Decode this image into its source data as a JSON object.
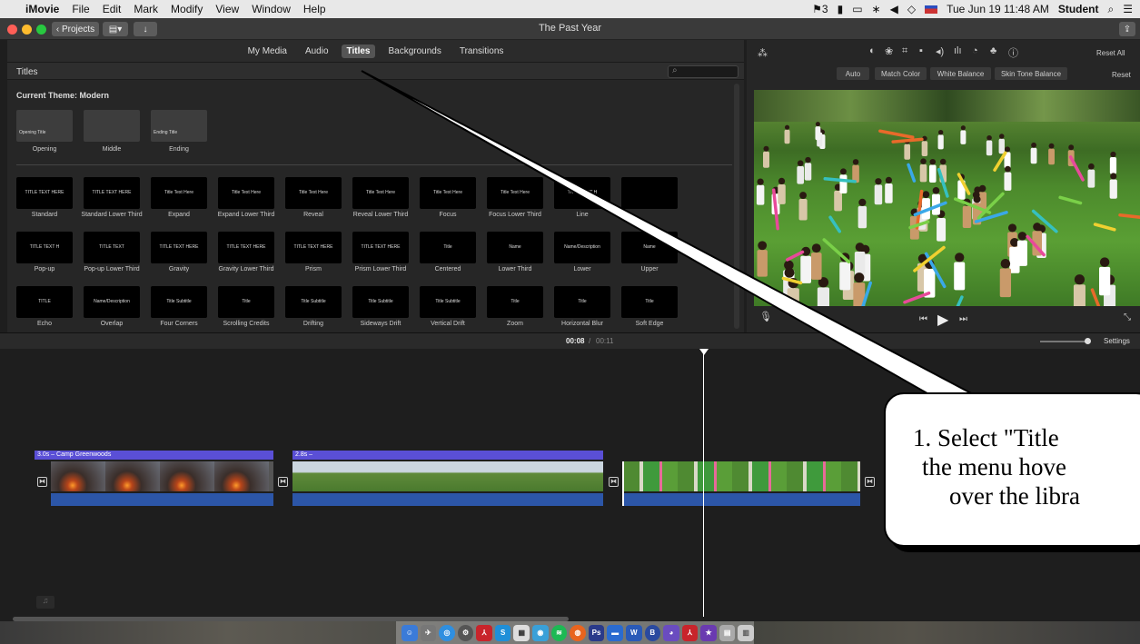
{
  "menubar": {
    "app": "iMovie",
    "items": [
      "File",
      "Edit",
      "Mark",
      "Modify",
      "View",
      "Window",
      "Help"
    ],
    "status": [
      "3",
      "Tue Jun 19  11:48 AM",
      "Student"
    ]
  },
  "toolbar": {
    "projects_label": "Projects",
    "title": "The Past Year"
  },
  "browser": {
    "tabs": [
      "My Media",
      "Audio",
      "Titles",
      "Backgrounds",
      "Transitions"
    ],
    "selected_tab": "Titles",
    "header": "Titles",
    "theme_label": "Current Theme: Modern",
    "theme_items": [
      {
        "label": "Opening",
        "text": "Opening Title"
      },
      {
        "label": "Middle",
        "text": ""
      },
      {
        "label": "Ending",
        "text": "Ending Title"
      }
    ],
    "rows": [
      [
        {
          "label": "Standard",
          "text": "TITLE TEXT HERE"
        },
        {
          "label": "Standard Lower Third",
          "text": "TITLE TEXT HERE"
        },
        {
          "label": "Expand",
          "text": "Title Text Here"
        },
        {
          "label": "Expand Lower Third",
          "text": "Title Text Here"
        },
        {
          "label": "Reveal",
          "text": "Title Text Here"
        },
        {
          "label": "Reveal Lower Third",
          "text": "Title Text Here"
        },
        {
          "label": "Focus",
          "text": "Title Text Here"
        },
        {
          "label": "Focus Lower Third",
          "text": "Title Text Here"
        },
        {
          "label": "Line",
          "text": "TITLE TEXT H"
        },
        {
          "label": "",
          "text": ""
        }
      ],
      [
        {
          "label": "Pop-up",
          "text": "TITLE TEXT H"
        },
        {
          "label": "Pop-up Lower Third",
          "text": "TITLE TEXT"
        },
        {
          "label": "Gravity",
          "text": "TITLE TEXT HERE"
        },
        {
          "label": "Gravity Lower Third",
          "text": "TITLE TEXT HERE"
        },
        {
          "label": "Prism",
          "text": "TITLE TEXT HERE"
        },
        {
          "label": "Prism Lower Third",
          "text": "TITLE TEXT HERE"
        },
        {
          "label": "Centered",
          "text": "Title"
        },
        {
          "label": "Lower Third",
          "text": "Name"
        },
        {
          "label": "Lower",
          "text": "Name/Description"
        },
        {
          "label": "Upper",
          "text": "Name"
        }
      ],
      [
        {
          "label": "Echo",
          "text": "TITLE"
        },
        {
          "label": "Overlap",
          "text": "Name/Description"
        },
        {
          "label": "Four Corners",
          "text": "Title Subtitle"
        },
        {
          "label": "Scrolling Credits",
          "text": "Title"
        },
        {
          "label": "Drifting",
          "text": "Title Subtitle"
        },
        {
          "label": "Sideways Drift",
          "text": "Title Subtitle"
        },
        {
          "label": "Vertical Drift",
          "text": "Title Subtitle"
        },
        {
          "label": "Zoom",
          "text": "Title"
        },
        {
          "label": "Horizontal Blur",
          "text": "Title"
        },
        {
          "label": "Soft Edge",
          "text": "Title"
        }
      ]
    ]
  },
  "viewer": {
    "reset_all": "Reset All",
    "reset": "Reset",
    "buttons": [
      "Auto",
      "Match Color",
      "White Balance",
      "Skin Tone Balance"
    ]
  },
  "timebar": {
    "current": "00:08",
    "separator": "/",
    "total": "00:11",
    "settings": "Settings"
  },
  "clips": [
    {
      "label": "3.0s – Camp Greenwoods"
    },
    {
      "label": "2.8s –"
    }
  ],
  "callout": {
    "lines": [
      "1. Select \"Title",
      "the menu hove",
      "over the libra"
    ]
  }
}
